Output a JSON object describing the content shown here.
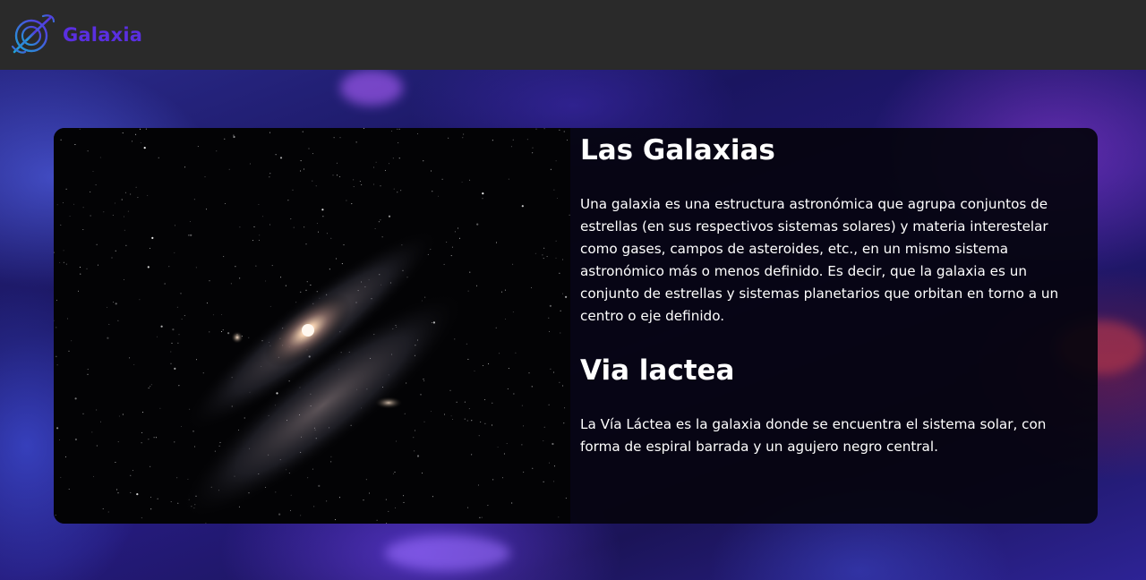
{
  "navbar": {
    "brand_name": "Galaxia",
    "logo_icon": "galaxy-planet-icon",
    "brand_color": "#5a2fe0",
    "background_color": "#2a2a2a"
  },
  "hero": {
    "background_description_color": "#2a2a8a"
  },
  "card": {
    "image_icon": "andromeda-galaxy-image",
    "sections": [
      {
        "title": "Las Galaxias",
        "body": "Una galaxia es una estructura astronómica que agrupa conjuntos de estrellas (en sus respectivos sistemas solares) y materia interestelar como gases, campos de asteroides, etc., en un mismo sistema astronómico más o menos definido. Es decir, que la galaxia es un conjunto de estrellas y sistemas planetarios que orbitan en torno a un centro o eje definido."
      },
      {
        "title": "Via lactea",
        "body": "La Vía Láctea es la galaxia donde se encuentra el sistema solar, con forma de espiral barrada y un agujero negro central."
      }
    ]
  }
}
